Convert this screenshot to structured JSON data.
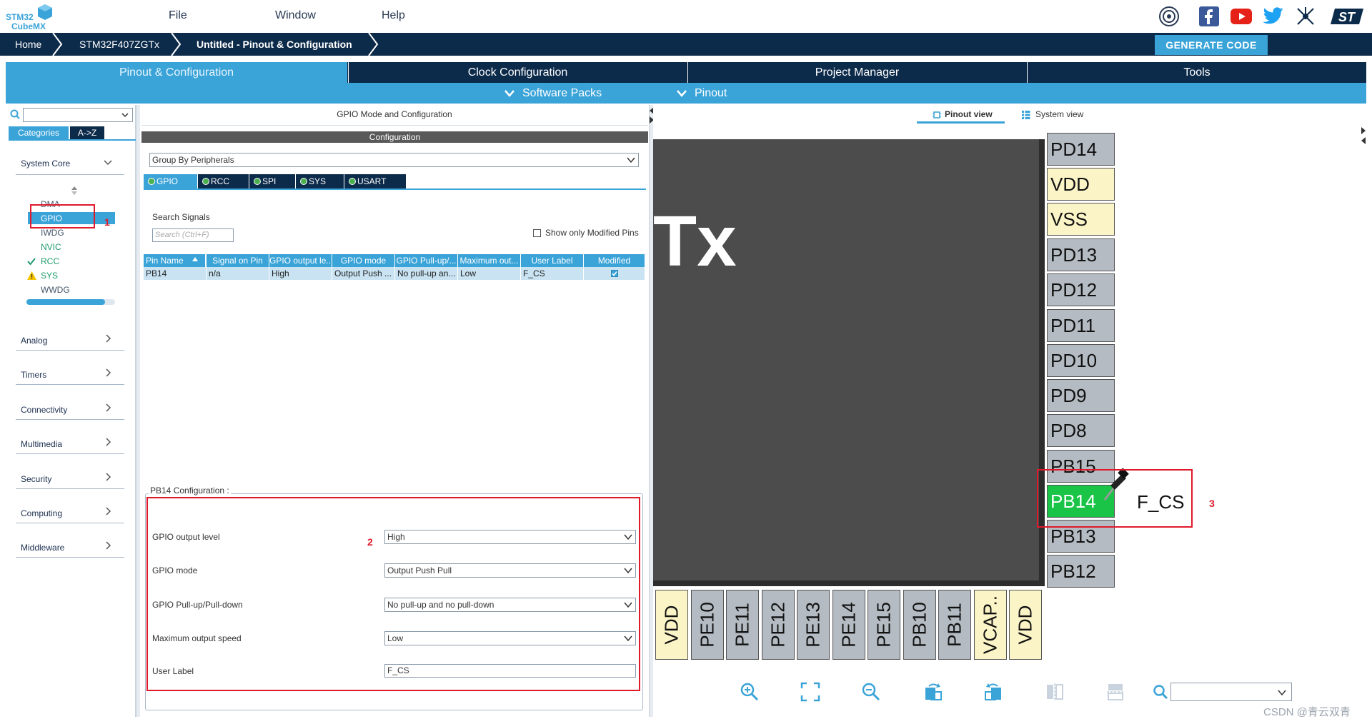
{
  "app": {
    "logo_line1": "STM32",
    "logo_line2": "CubeMX"
  },
  "menu": {
    "file": "File",
    "window": "Window",
    "help": "Help"
  },
  "breadcrumb": {
    "home": "Home",
    "mcu": "STM32F407ZGTx",
    "current": "Untitled - Pinout & Configuration"
  },
  "generate_code": "GENERATE CODE",
  "main_tabs": [
    "Pinout & Configuration",
    "Clock Configuration",
    "Project Manager",
    "Tools"
  ],
  "sub_tabs": {
    "software_packs": "Software Packs",
    "pinout": "Pinout"
  },
  "left": {
    "tab_categories": "Categories",
    "tab_az": "A->Z",
    "system_core": "System Core",
    "system_core_items": [
      "DMA",
      "GPIO",
      "IWDG",
      "NVIC",
      "RCC",
      "SYS",
      "WWDG"
    ],
    "categories": [
      "Analog",
      "Timers",
      "Connectivity",
      "Multimedia",
      "Security",
      "Computing",
      "Middleware"
    ]
  },
  "middle": {
    "title": "GPIO Mode and Configuration",
    "configuration": "Configuration",
    "group_by": "Group By Peripherals",
    "periph_tabs": [
      "GPIO",
      "RCC",
      "SPI",
      "SYS",
      "USART"
    ],
    "search_signals": "Search Signals",
    "search_placeholder": "Search (Ctrl+F)",
    "show_modified": "Show only Modified Pins",
    "table_headers": [
      "Pin Name",
      "Signal on Pin",
      "GPIO output le...",
      "GPIO mode",
      "GPIO Pull-up/...",
      "Maximum out...",
      "User Label",
      "Modified"
    ],
    "table_row": [
      "PB14",
      "n/a",
      "High",
      "Output Push ...",
      "No pull-up an...",
      "Low",
      "F_CS"
    ],
    "pin_config_title": "PB14 Configuration :",
    "fields": [
      {
        "label": "GPIO output level",
        "value": "High"
      },
      {
        "label": "GPIO mode",
        "value": "Output Push Pull"
      },
      {
        "label": "GPIO Pull-up/Pull-down",
        "value": "No pull-up and no pull-down"
      },
      {
        "label": "Maximum output speed",
        "value": "Low"
      },
      {
        "label": "User Label",
        "value": "F_CS"
      }
    ]
  },
  "annotations": {
    "n1": "1",
    "n2": "2",
    "n3": "3"
  },
  "right": {
    "pinout_view": "Pinout view",
    "system_view": "System view",
    "chip_text": "Tx",
    "right_pins": [
      "PD14",
      "VDD",
      "VSS",
      "PD13",
      "PD12",
      "PD11",
      "PD10",
      "PD9",
      "PD8",
      "PB15",
      "PB14",
      "PB13",
      "PB12"
    ],
    "bottom_pins": [
      "VDD",
      "PE10",
      "PE11",
      "PE12",
      "PE13",
      "PE14",
      "PE15",
      "PB10",
      "PB11",
      "VCAP..",
      "VDD"
    ],
    "pin_label": "F_CS"
  },
  "watermark": "CSDN @青云双青",
  "colors": {
    "navy": "#0c2a4a",
    "accent": "#3aa3d8",
    "pin_active": "#19c447",
    "power_pin": "#fbf4c7",
    "annotation_red": "#e0192a"
  }
}
